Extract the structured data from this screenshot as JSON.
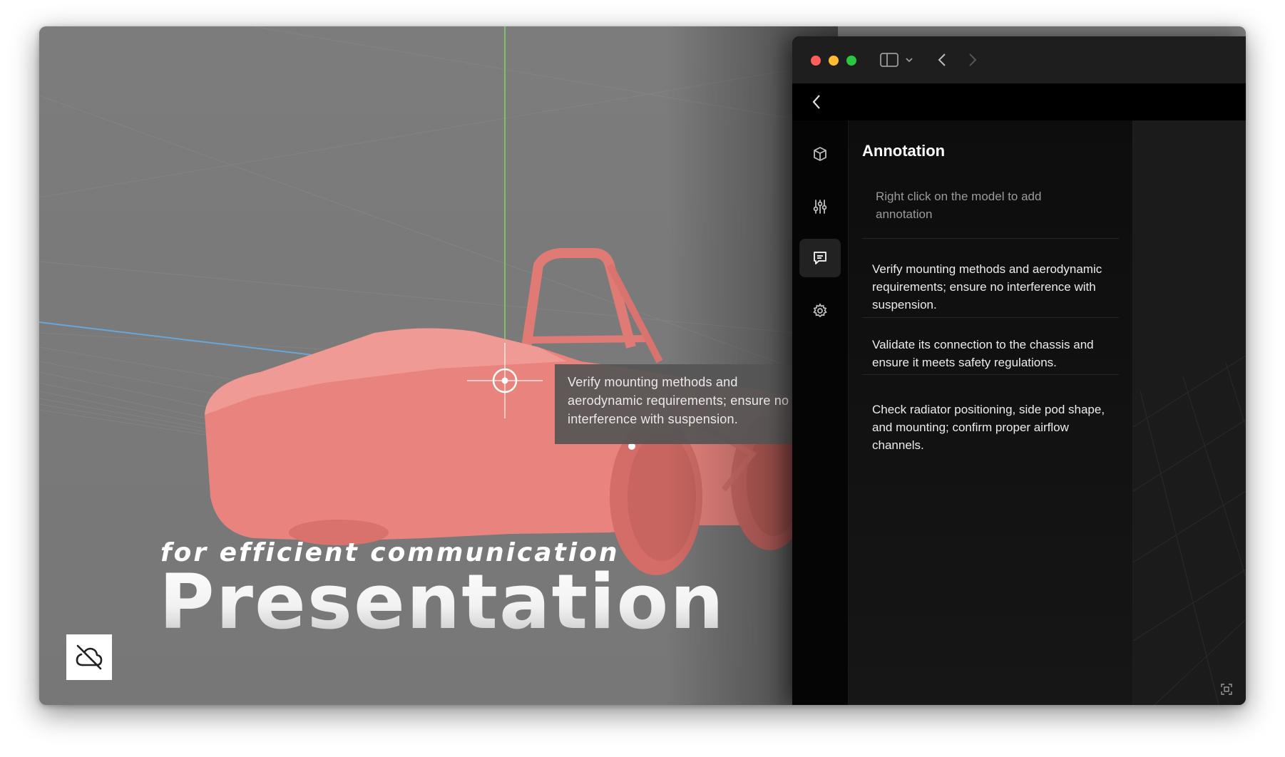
{
  "viewport": {
    "callout_text": "Verify mounting methods and aerodynamic requirements; ensure no interference with suspension.",
    "subtitle": "for efficient communication",
    "title": "Presentation",
    "model_color": "#e8837e"
  },
  "icons": {
    "logo": "cloud-off-icon",
    "sidebar_toggle": "sidebar-icon",
    "dropdown": "chevron-down-icon",
    "back": "chevron-left-icon",
    "forward": "chevron-right-icon",
    "model": "cube-icon",
    "adjust": "sliders-icon",
    "annotation": "comment-icon",
    "settings": "gear-icon",
    "screenshot": "screenshot-icon"
  },
  "app": {
    "panel": {
      "title": "Annotation",
      "hint": "Right click on the model to add annotation",
      "annotations": [
        "Verify mounting methods and aerodynamic requirements; ensure no interference with suspension.",
        "Validate its connection to the chassis and ensure it meets safety regulations.",
        "Check radiator positioning, side pod shape, and mounting; confirm proper airflow channels."
      ]
    },
    "traffic_lights": [
      "#ff5f57",
      "#febc2e",
      "#28c840"
    ]
  }
}
